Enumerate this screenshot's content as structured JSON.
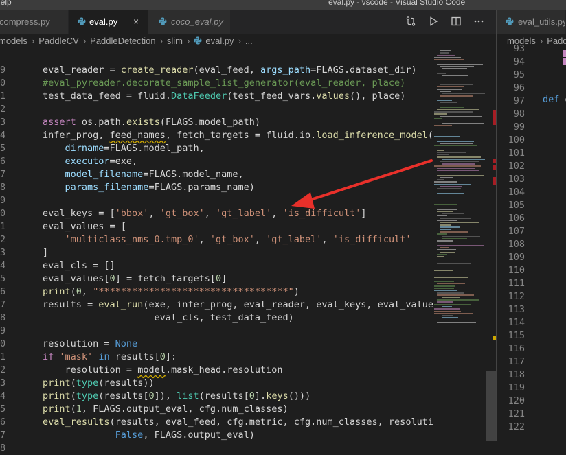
{
  "window": {
    "menu_fragment": "lelp",
    "title": "eval.py - vscode - Visual Studio Code"
  },
  "left_pane": {
    "tabs": [
      {
        "label": "compress.py",
        "italic": false,
        "active": false
      },
      {
        "label": "eval.py",
        "italic": false,
        "active": true,
        "close": "×"
      },
      {
        "label": "coco_eval.py",
        "italic": true,
        "active": false
      }
    ],
    "breadcrumb": [
      "models",
      "PaddleCV",
      "PaddleDetection",
      "slim",
      "eval.py",
      "..."
    ],
    "visible_line_numbers": [
      "",
      "9",
      "0",
      "1",
      "2",
      "3",
      "4",
      "5",
      "6",
      "7",
      "8",
      "9",
      "0",
      "1",
      "2",
      "3",
      "4",
      "5",
      "6",
      "7",
      "8",
      "9",
      "0",
      "1",
      "2",
      "3",
      "4",
      "5",
      "6",
      "7",
      "8"
    ],
    "code_lines": [
      {
        "indent": 0,
        "tokens": [
          {
            "t": "    ",
            "c": ""
          }
        ]
      },
      {
        "indent": 0,
        "tokens": [
          {
            "t": "eval_reader = ",
            "c": ""
          },
          {
            "t": "create_reader",
            "c": "fn"
          },
          {
            "t": "(eval_feed, ",
            "c": ""
          },
          {
            "t": "args_path",
            "c": "pm"
          },
          {
            "t": "=FLAGS.dataset_dir)",
            "c": ""
          }
        ]
      },
      {
        "indent": 0,
        "tokens": [
          {
            "t": "#eval_pyreader.decorate_sample_list_generator(eval_reader, place)",
            "c": "cm"
          }
        ]
      },
      {
        "indent": 0,
        "tokens": [
          {
            "t": "test_data_feed = fluid.",
            "c": ""
          },
          {
            "t": "DataFeeder",
            "c": "bi"
          },
          {
            "t": "(test_feed_vars.",
            "c": ""
          },
          {
            "t": "values",
            "c": "fn"
          },
          {
            "t": "(), place)",
            "c": ""
          }
        ]
      },
      {
        "indent": 0,
        "tokens": []
      },
      {
        "indent": 0,
        "tokens": [
          {
            "t": "assert",
            "c": "kw"
          },
          {
            "t": " os.path.",
            "c": ""
          },
          {
            "t": "exists",
            "c": "fn"
          },
          {
            "t": "(FLAGS.model_path)",
            "c": ""
          }
        ]
      },
      {
        "indent": 0,
        "tokens": [
          {
            "t": "infer_prog, ",
            "c": ""
          },
          {
            "t": "feed_names",
            "c": "sq"
          },
          {
            "t": ", fetch_targets = fluid.io.",
            "c": ""
          },
          {
            "t": "load_inference_model",
            "c": "fn"
          },
          {
            "t": "(",
            "c": ""
          }
        ]
      },
      {
        "indent": 1,
        "tokens": [
          {
            "t": "dirname",
            "c": "pm"
          },
          {
            "t": "=FLAGS.model_path,",
            "c": ""
          }
        ]
      },
      {
        "indent": 1,
        "tokens": [
          {
            "t": "executor",
            "c": "pm"
          },
          {
            "t": "=exe,",
            "c": ""
          }
        ]
      },
      {
        "indent": 1,
        "tokens": [
          {
            "t": "model_filename",
            "c": "pm"
          },
          {
            "t": "=FLAGS.model_name,",
            "c": ""
          }
        ]
      },
      {
        "indent": 1,
        "tokens": [
          {
            "t": "params_filename",
            "c": "pm"
          },
          {
            "t": "=FLAGS.params_name)",
            "c": ""
          }
        ]
      },
      {
        "indent": 0,
        "tokens": []
      },
      {
        "indent": 0,
        "tokens": [
          {
            "t": "eval_keys = [",
            "c": ""
          },
          {
            "t": "'bbox'",
            "c": "st"
          },
          {
            "t": ", ",
            "c": ""
          },
          {
            "t": "'gt_box'",
            "c": "st"
          },
          {
            "t": ", ",
            "c": ""
          },
          {
            "t": "'gt_label'",
            "c": "st"
          },
          {
            "t": ", ",
            "c": ""
          },
          {
            "t": "'is_difficult'",
            "c": "st"
          },
          {
            "t": "]",
            "c": ""
          }
        ]
      },
      {
        "indent": 0,
        "tokens": [
          {
            "t": "eval_values = [",
            "c": ""
          }
        ]
      },
      {
        "indent": 1,
        "tokens": [
          {
            "t": "'multiclass_nms_0.tmp_0'",
            "c": "st"
          },
          {
            "t": ", ",
            "c": ""
          },
          {
            "t": "'gt_box'",
            "c": "st"
          },
          {
            "t": ", ",
            "c": ""
          },
          {
            "t": "'gt_label'",
            "c": "st"
          },
          {
            "t": ", ",
            "c": ""
          },
          {
            "t": "'is_difficult'",
            "c": "st"
          }
        ]
      },
      {
        "indent": 0,
        "tokens": [
          {
            "t": "]",
            "c": ""
          }
        ]
      },
      {
        "indent": 0,
        "tokens": [
          {
            "t": "eval_cls = []",
            "c": ""
          }
        ]
      },
      {
        "indent": 0,
        "tokens": [
          {
            "t": "eval_values[",
            "c": ""
          },
          {
            "t": "0",
            "c": "nm"
          },
          {
            "t": "] = fetch_targets[",
            "c": ""
          },
          {
            "t": "0",
            "c": "nm"
          },
          {
            "t": "]",
            "c": ""
          }
        ]
      },
      {
        "indent": 0,
        "tokens": [
          {
            "t": "print",
            "c": "fn"
          },
          {
            "t": "(",
            "c": ""
          },
          {
            "t": "0",
            "c": "nm"
          },
          {
            "t": ", ",
            "c": ""
          },
          {
            "t": "\"**********************************\"",
            "c": "st"
          },
          {
            "t": ")",
            "c": ""
          }
        ]
      },
      {
        "indent": 0,
        "tokens": [
          {
            "t": "results = ",
            "c": ""
          },
          {
            "t": "eval_run",
            "c": "fn"
          },
          {
            "t": "(exe, infer_prog, eval_reader, eval_keys, eval_values,",
            "c": ""
          }
        ]
      },
      {
        "indent": 0,
        "tokens": [
          {
            "t": "                    eval_cls, test_data_feed)",
            "c": ""
          }
        ]
      },
      {
        "indent": 0,
        "tokens": []
      },
      {
        "indent": 0,
        "tokens": [
          {
            "t": "resolution = ",
            "c": ""
          },
          {
            "t": "None",
            "c": "k2"
          }
        ]
      },
      {
        "indent": 0,
        "tokens": [
          {
            "t": "if",
            "c": "kw"
          },
          {
            "t": " ",
            "c": ""
          },
          {
            "t": "'mask'",
            "c": "st"
          },
          {
            "t": " ",
            "c": ""
          },
          {
            "t": "in",
            "c": "k2"
          },
          {
            "t": " results[",
            "c": ""
          },
          {
            "t": "0",
            "c": "nm"
          },
          {
            "t": "]:",
            "c": ""
          }
        ]
      },
      {
        "indent": 1,
        "tokens": [
          {
            "t": "resolution = ",
            "c": ""
          },
          {
            "t": "model",
            "c": "sq"
          },
          {
            "t": ".mask_head.resolution",
            "c": ""
          }
        ]
      },
      {
        "indent": 0,
        "tokens": [
          {
            "t": "print",
            "c": "fn"
          },
          {
            "t": "(",
            "c": ""
          },
          {
            "t": "type",
            "c": "bi"
          },
          {
            "t": "(results))",
            "c": ""
          }
        ]
      },
      {
        "indent": 0,
        "tokens": [
          {
            "t": "print",
            "c": "fn"
          },
          {
            "t": "(",
            "c": ""
          },
          {
            "t": "type",
            "c": "bi"
          },
          {
            "t": "(results[",
            "c": ""
          },
          {
            "t": "0",
            "c": "nm"
          },
          {
            "t": "]), ",
            "c": ""
          },
          {
            "t": "list",
            "c": "bi"
          },
          {
            "t": "(results[",
            "c": ""
          },
          {
            "t": "0",
            "c": "nm"
          },
          {
            "t": "].",
            "c": ""
          },
          {
            "t": "keys",
            "c": "fn"
          },
          {
            "t": "()))",
            "c": ""
          }
        ]
      },
      {
        "indent": 0,
        "tokens": [
          {
            "t": "print",
            "c": "fn"
          },
          {
            "t": "(",
            "c": ""
          },
          {
            "t": "1",
            "c": "nm"
          },
          {
            "t": ", FLAGS.output_eval, cfg.num_classes)",
            "c": ""
          }
        ]
      },
      {
        "indent": 0,
        "tokens": [
          {
            "t": "eval_results",
            "c": "fn"
          },
          {
            "t": "(results, eval_feed, cfg.metric, cfg.num_classes, resolution,",
            "c": ""
          }
        ]
      },
      {
        "indent": 0,
        "tokens": [
          {
            "t": "             ",
            "c": ""
          },
          {
            "t": "False",
            "c": "k2"
          },
          {
            "t": ", FLAGS.output_eval)",
            "c": ""
          }
        ]
      }
    ]
  },
  "right_pane": {
    "tab_label": "eval_utils.py",
    "breadcrumb": [
      "models",
      "Padd"
    ],
    "line_numbers": [
      "93",
      "94",
      "95",
      "96",
      "97",
      "98",
      "99",
      "100",
      "101",
      "102",
      "103",
      "104",
      "105",
      "106",
      "107",
      "108",
      "109",
      "110",
      "111",
      "112",
      "113",
      "114",
      "115",
      "116",
      "117",
      "118",
      "119",
      "120",
      "121",
      "122"
    ],
    "def_keyword": "def",
    "def_rest": " e"
  },
  "colors": {
    "accent_arrow": "#e8302a",
    "editor_bg": "#1e1e1e",
    "tab_bg": "#2d2d2d"
  },
  "icons": [
    "python-file-icon",
    "compare-changes-icon",
    "run-icon",
    "split-editor-icon",
    "more-actions-icon"
  ]
}
